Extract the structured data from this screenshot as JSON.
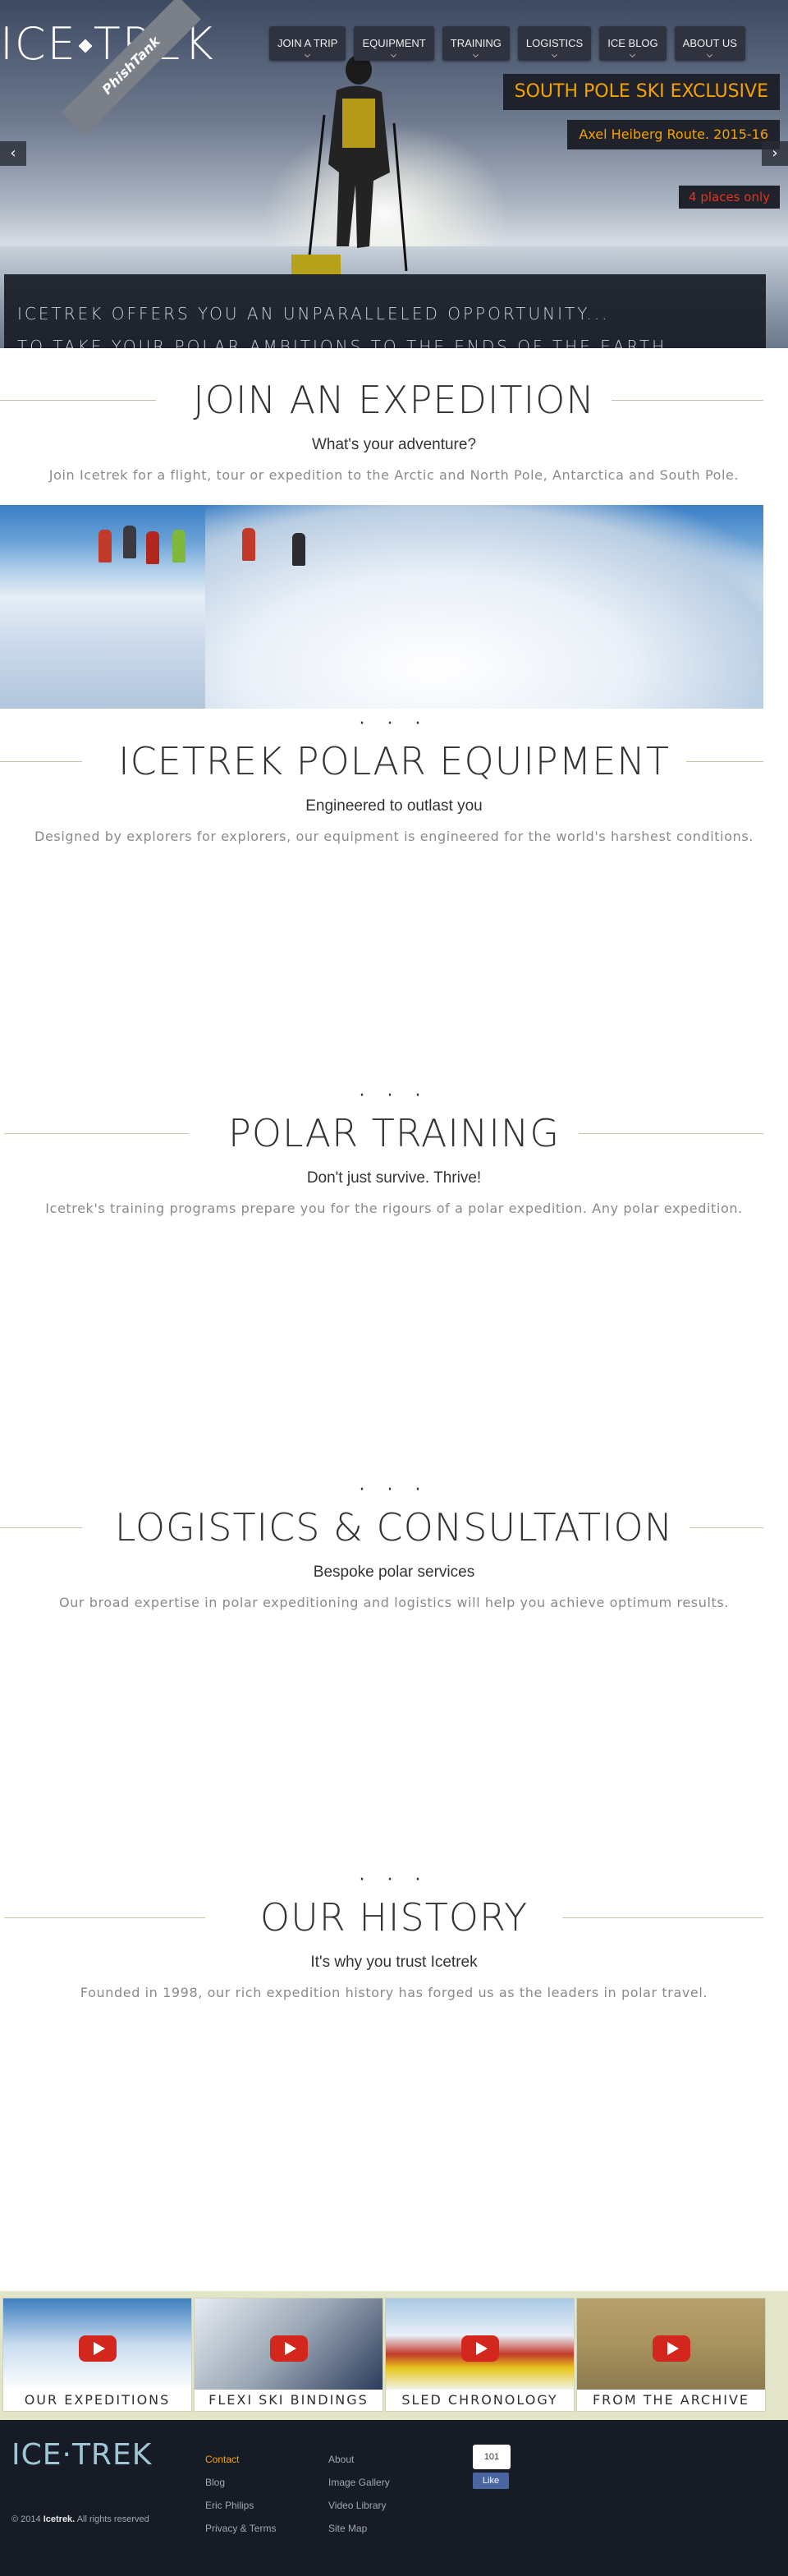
{
  "brand": {
    "logo_left": "ICE",
    "logo_right": "TREK",
    "ribbon": "PhishTank"
  },
  "nav": [
    {
      "label": "JOIN A TRIP"
    },
    {
      "label": "EQUIPMENT"
    },
    {
      "label": "TRAINING"
    },
    {
      "label": "LOGISTICS"
    },
    {
      "label": "ICE BLOG"
    },
    {
      "label": "ABOUT US"
    }
  ],
  "hero": {
    "promo_title": "SOUTH POLE SKI EXCLUSIVE",
    "promo_sub": "Axel Heiberg Route. 2015-16",
    "promo_places": "4 places only",
    "banner_line1": "ICETREK OFFERS YOU AN UNPARALLELED OPPORTUNITY...",
    "banner_line2": "TO TAKE YOUR POLAR AMBITIONS TO THE ENDS OF THE EARTH",
    "arrow_left": "‹",
    "arrow_right": "›"
  },
  "sections": [
    {
      "title": "JOIN AN EXPEDITION",
      "subtitle": "What's your adventure?",
      "desc": "Join Icetrek for a flight, tour or expedition to the Arctic and North Pole, Antarctica and South Pole."
    },
    {
      "title": "ICETREK POLAR EQUIPMENT",
      "subtitle": "Engineered to outlast you",
      "desc": "Designed by explorers for explorers, our equipment is engineered for the world's harshest conditions."
    },
    {
      "title": "POLAR TRAINING",
      "subtitle": "Don't just survive. Thrive!",
      "desc": "Icetrek's training programs prepare you for the rigours of a polar expedition. Any polar expedition."
    },
    {
      "title": "LOGISTICS & CONSULTATION",
      "subtitle": "Bespoke polar services",
      "desc": "Our broad expertise in polar expeditioning and logistics will help you achieve optimum results."
    },
    {
      "title": "OUR HISTORY",
      "subtitle": "It's why you trust Icetrek",
      "desc": "Founded in 1998, our rich expedition history has forged us as the leaders in polar travel."
    }
  ],
  "dots": "· · ·",
  "gallery": [
    {
      "label": "OUR EXPEDITIONS"
    },
    {
      "label": "FLEXI SKI BINDINGS"
    },
    {
      "label": "SLED CHRONOLOGY"
    },
    {
      "label": "FROM THE ARCHIVE"
    }
  ],
  "footer": {
    "logo": "ICE·TREK",
    "copy_prefix": "© 2014",
    "copy_brand": "Icetrek.",
    "copy_suffix": "All rights reserved",
    "col1": [
      "Contact",
      "Blog",
      "Eric Philips",
      "Privacy & Terms"
    ],
    "col2": [
      "About",
      "Image Gallery",
      "Video Library",
      "Site Map"
    ],
    "fb_count": "101",
    "fb_like": "Like"
  },
  "colors": {
    "accent": "#f5a100",
    "dark": "#1f222b",
    "red": "#e6341c",
    "rule": "#c9c0a4"
  }
}
